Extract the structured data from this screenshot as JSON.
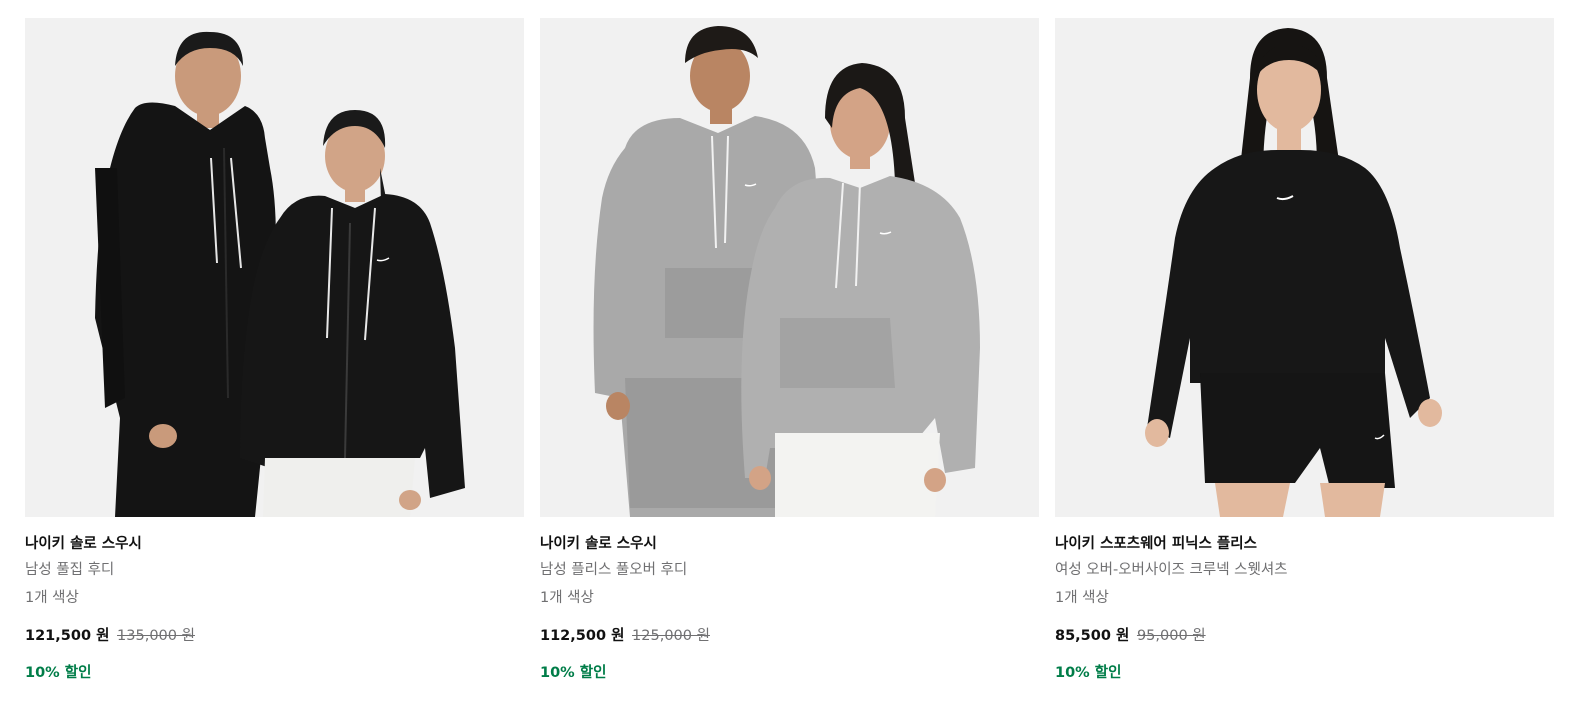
{
  "products": [
    {
      "title": "나이키 솔로 스우시",
      "subtitle": "남성 풀집 후디",
      "colors": "1개 색상",
      "price": "121,500 원",
      "original_price": "135,000 원",
      "discount": "10% 할인"
    },
    {
      "title": "나이키 솔로 스우시",
      "subtitle": "남성 플리스 풀오버 후디",
      "colors": "1개 색상",
      "price": "112,500 원",
      "original_price": "125,000 원",
      "discount": "10% 할인"
    },
    {
      "title": "나이키 스포츠웨어 피닉스 플리스",
      "subtitle": "여성 오버-오버사이즈 크루넥 스웻셔츠",
      "colors": "1개 색상",
      "price": "85,500 원",
      "original_price": "95,000 원",
      "discount": "10% 할인"
    }
  ],
  "colors": {
    "image_bg": "#f1f1f1",
    "discount_green": "#007d48",
    "muted_text": "#707072"
  }
}
